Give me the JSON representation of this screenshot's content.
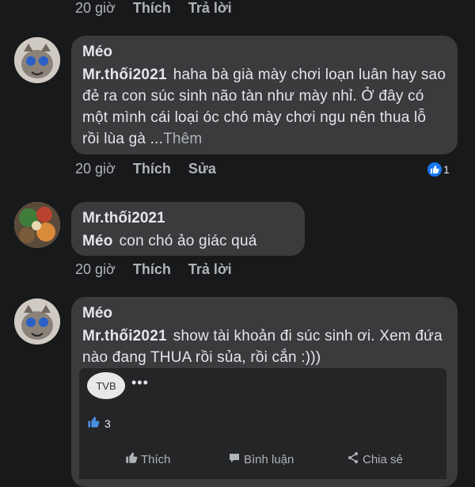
{
  "top_meta": {
    "time": "20 giờ",
    "like": "Thích",
    "reply": "Trả lời"
  },
  "comments": [
    {
      "author": "Méo",
      "mention": "Mr.thối2021",
      "text": "haha bà già mày chơi loạn luân hay sao đẻ ra con súc sinh não tàn như mày nhỉ. Ở đây có một mình cái loại óc chó mày chơi ngu nên thua lỗ rồi lùa gà ...",
      "more": "Thêm",
      "time": "20 giờ",
      "like": "Thích",
      "action": "Sửa",
      "reactions": "1"
    },
    {
      "author": "Mr.thối2021",
      "mention": "Méo",
      "text": "con chó ảo giác quá",
      "time": "20 giờ",
      "like": "Thích",
      "action": "Trả lời"
    },
    {
      "author": "Méo",
      "mention": "Mr.thối2021",
      "text": "show tài khoản đi súc sinh ơi. Xem đứa nào đang THUA rồi sủa, rồi cắn :)))"
    }
  ],
  "shared_card": {
    "avatar_text": "TVB",
    "reactions": "3",
    "like": "Thích",
    "comment": "Bình luận",
    "share": "Chia sẻ"
  },
  "colors": {
    "bg": "#18191a",
    "bubble": "#3a3b3c",
    "accent": "#1877f2"
  }
}
